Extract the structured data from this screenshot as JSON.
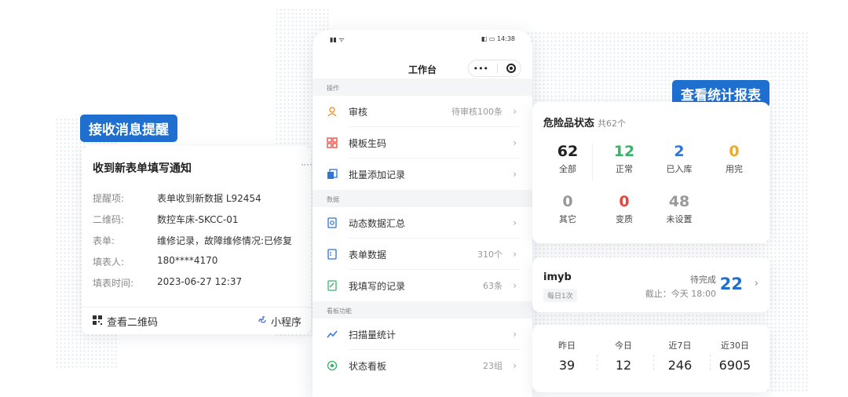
{
  "tags": {
    "receive": "接收消息提醒",
    "report": "查看统计报表"
  },
  "message": {
    "title": "收到新表单填写通知",
    "rows": [
      {
        "key": "提醒项:",
        "value": "表单收到新数据 L92454"
      },
      {
        "key": "二维码:",
        "value": "数控车床-SKCC-01"
      },
      {
        "key": "表单:",
        "value": "维修记录，故障维修情况:已修复"
      },
      {
        "key": "填表人:",
        "value": "180****4170"
      },
      {
        "key": "填表时间:",
        "value": "2023-06-27 12:37"
      }
    ],
    "view_qr": "查看二维码",
    "mini_program": "小程序"
  },
  "phone": {
    "time": "14:38",
    "title": "工作台",
    "capsule_dots": "•••",
    "sections": {
      "ops": "操作",
      "data": "数据",
      "board": "看板功能"
    },
    "items": [
      {
        "label": "审核",
        "value": "待审核100条"
      },
      {
        "label": "模板生码",
        "value": ""
      },
      {
        "label": "批量添加记录",
        "value": ""
      },
      {
        "label": "动态数据汇总",
        "value": ""
      },
      {
        "label": "表单数据",
        "value": "310个"
      },
      {
        "label": "我填写的记录",
        "value": "63条"
      },
      {
        "label": "扫描量统计",
        "value": ""
      },
      {
        "label": "状态看板",
        "value": "23组"
      }
    ]
  },
  "stats": {
    "title": "危险品状态",
    "total": "共62个",
    "cells": [
      {
        "num": "62",
        "label": "全部",
        "color": "#222222"
      },
      {
        "num": "12",
        "label": "正常",
        "color": "#3bb26a"
      },
      {
        "num": "2",
        "label": "已入库",
        "color": "#2f74d6"
      },
      {
        "num": "0",
        "label": "用完",
        "color": "#f1a928"
      },
      {
        "num": "0",
        "label": "其它",
        "color": "#999999"
      },
      {
        "num": "0",
        "label": "变质",
        "color": "#e8453c"
      },
      {
        "num": "48",
        "label": "未设置",
        "color": "#999999"
      }
    ]
  },
  "task": {
    "name": "imyb",
    "frequency": "每日1次",
    "status": "待完成",
    "deadline": "截止：今天 18:00",
    "count": "22"
  },
  "counts": [
    {
      "label": "昨日",
      "num": "39"
    },
    {
      "label": "今日",
      "num": "12"
    },
    {
      "label": "近7日",
      "num": "246"
    },
    {
      "label": "近30日",
      "num": "6905"
    }
  ],
  "colors": {
    "accent": "#1f6fd1"
  }
}
